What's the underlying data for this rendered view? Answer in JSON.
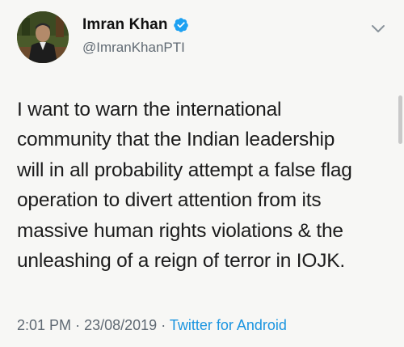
{
  "tweet": {
    "author": {
      "name": "Imran Khan",
      "handle": "@ImranKhanPTI",
      "verified": true
    },
    "body_lines": [
      "I want to warn the international",
      "community that the Indian leadership",
      "will in all probability attempt a false flag",
      "operation to divert attention from its",
      "massive human rights violations & the",
      "unleashing of a reign of terror in IOJK."
    ],
    "time": "2:01 PM",
    "separator": "·",
    "date": "23/08/2019",
    "source": "Twitter for Android"
  },
  "icons": {
    "verified": "verified-badge-icon",
    "menu": "chevron-down-icon"
  },
  "colors": {
    "background": "#f7f7f5",
    "verified_blue": "#1da1f2",
    "link_blue": "#1b95e0",
    "secondary_text": "#606a73"
  }
}
